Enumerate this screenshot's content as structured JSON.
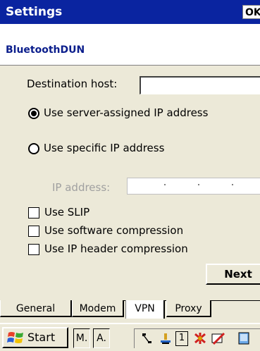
{
  "title_bar": {
    "title": "Settings",
    "ok_label": "OK"
  },
  "connection": {
    "name": "BluetoothDUN"
  },
  "form": {
    "destination_host": {
      "label": "Destination host:",
      "value": ""
    },
    "radio_server": {
      "label": "Use server-assigned IP address",
      "checked": true
    },
    "radio_specific": {
      "label": "Use specific IP address",
      "checked": false
    },
    "ip_address": {
      "label": "IP address:",
      "separator": "."
    },
    "use_slip": {
      "label": "Use SLIP",
      "checked": false
    },
    "software_compression": {
      "label": "Use software compression",
      "checked": false
    },
    "ip_header_compression": {
      "label": "Use IP header compression",
      "checked": false
    },
    "next_label": "Next"
  },
  "tabs": [
    {
      "label": "General"
    },
    {
      "label": "Modem"
    },
    {
      "label": "VPN",
      "active": true
    },
    {
      "label": "Proxy"
    }
  ],
  "taskbar": {
    "start_label": "Start",
    "tasks": [
      "M.",
      "A."
    ],
    "tray_icons": [
      "connection-icon",
      "tools-icon",
      "input-number-icon",
      "bluetooth-icon",
      "pen-icon",
      "desktop-icon"
    ],
    "tray_number": "1"
  },
  "colors": {
    "title_bg": "#0a24a0",
    "accent_text": "#0b1e8c",
    "window_bg": "#ece9d8"
  }
}
